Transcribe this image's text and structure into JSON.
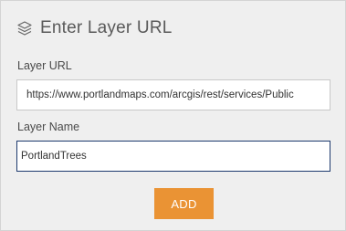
{
  "dialog": {
    "title": "Enter Layer URL",
    "icon": "layers-icon"
  },
  "fields": {
    "layer_url": {
      "label": "Layer URL",
      "value": "https://www.portlandmaps.com/arcgis/rest/services/Public"
    },
    "layer_name": {
      "label": "Layer Name",
      "value": "PortlandTrees"
    }
  },
  "actions": {
    "add_label": "ADD"
  },
  "colors": {
    "panel_bg": "#efefef",
    "accent": "#ea9334",
    "focus_border": "#1d3a6e"
  }
}
